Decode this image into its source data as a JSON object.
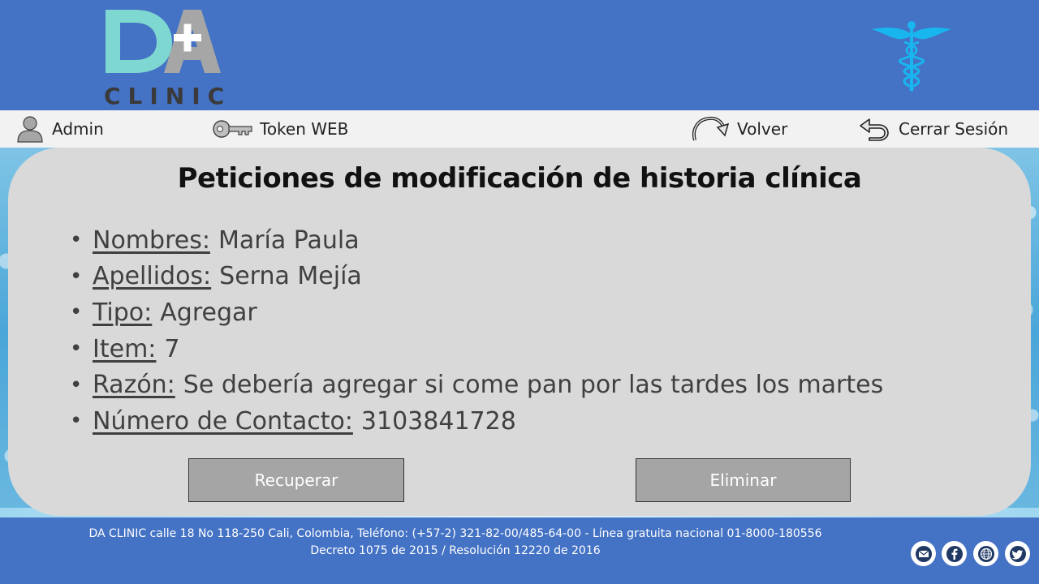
{
  "header": {
    "logo_letters": "DA",
    "logo_word": "CLINIC",
    "right_icon": "caduceus-icon"
  },
  "nav": {
    "admin": "Admin",
    "token": "Token WEB",
    "volver": "Volver",
    "cerrar": "Cerrar Sesión"
  },
  "main": {
    "title": "Peticiones de modificación de historia clínica",
    "details": [
      {
        "key": "Nombres:",
        "value": "María Paula"
      },
      {
        "key": "Apellidos:",
        "value": "Serna Mejía"
      },
      {
        "key": "Tipo:",
        "value": "Agregar"
      },
      {
        "key": "Item:",
        "value": "7"
      },
      {
        "key": "Razón:",
        "value": "Se debería agregar si come pan por las tardes los martes"
      },
      {
        "key": "Número de Contacto:",
        "value": "3103841728"
      }
    ],
    "recuperar_label": "Recuperar",
    "eliminar_label": "Eliminar"
  },
  "footer": {
    "line1": "DA CLINIC calle 18 No 118-250 Cali, Colombia, Teléfono: (+57-2) 321-82-00/485-64-00 - Línea gratuita nacional 01-8000-180556",
    "line2": "Decreto 1075 de 2015 / Resolución 12220 de 2016",
    "social_icons": [
      "mail-icon",
      "facebook-icon",
      "globe-icon",
      "twitter-icon"
    ]
  },
  "colors": {
    "brand_blue": "#4472c4",
    "logo_teal": "#7ed7d0",
    "logo_gray": "#a6a6a6",
    "card_gray": "#d9d9d9",
    "button_gray": "#a5a5a5",
    "caduceus_cyan": "#19b5ef"
  }
}
